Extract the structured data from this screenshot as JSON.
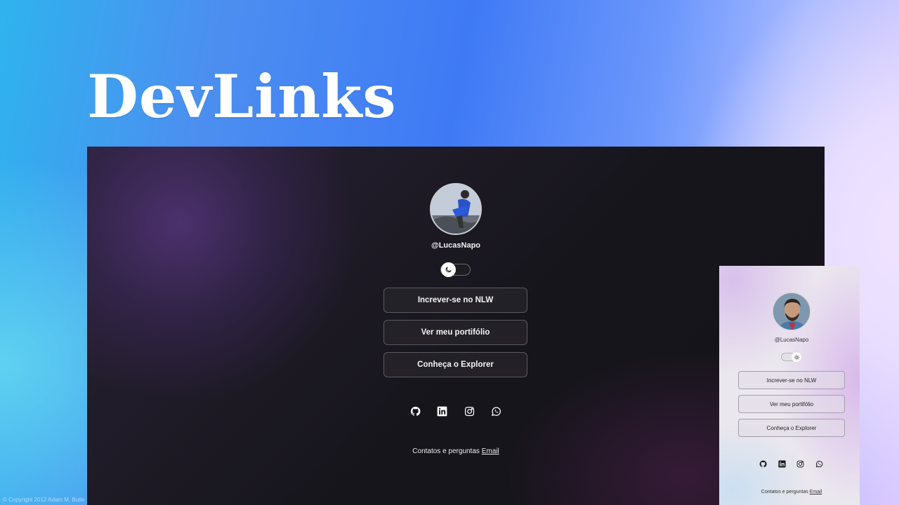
{
  "hero": {
    "title": "DevLinks"
  },
  "copyright": "© Copyright 2012 Adam M. Butle",
  "desktop_preview": {
    "theme": "dark",
    "username": "@LucasNapo",
    "toggle_state": "dark",
    "buttons": [
      {
        "label": "Increver-se no NLW"
      },
      {
        "label": "Ver meu portifólio"
      },
      {
        "label": "Conheça o Explorer"
      }
    ],
    "social_icons": [
      "github-icon",
      "linkedin-icon",
      "instagram-icon",
      "whatsapp-icon"
    ],
    "footer": {
      "text": "Contatos e perguntas",
      "link": "Email"
    }
  },
  "mobile_preview": {
    "theme": "light",
    "username": "@LucasNapo",
    "toggle_state": "light",
    "buttons": [
      {
        "label": "Increver-se no NLW"
      },
      {
        "label": "Ver meu portifólio"
      },
      {
        "label": "Conheça o Explorer"
      }
    ],
    "social_icons": [
      "github-icon",
      "linkedin-icon",
      "instagram-icon",
      "whatsapp-icon"
    ],
    "footer": {
      "text": "Contatos e perguntas",
      "link": "Email"
    }
  },
  "colors": {
    "background_blue": "#3f7af5",
    "dark_bg": "#16151b",
    "dark_accent_purple": "#4e3270",
    "light_bg": "#ebe7ee",
    "light_accent_lilac": "#d6b4ec"
  }
}
